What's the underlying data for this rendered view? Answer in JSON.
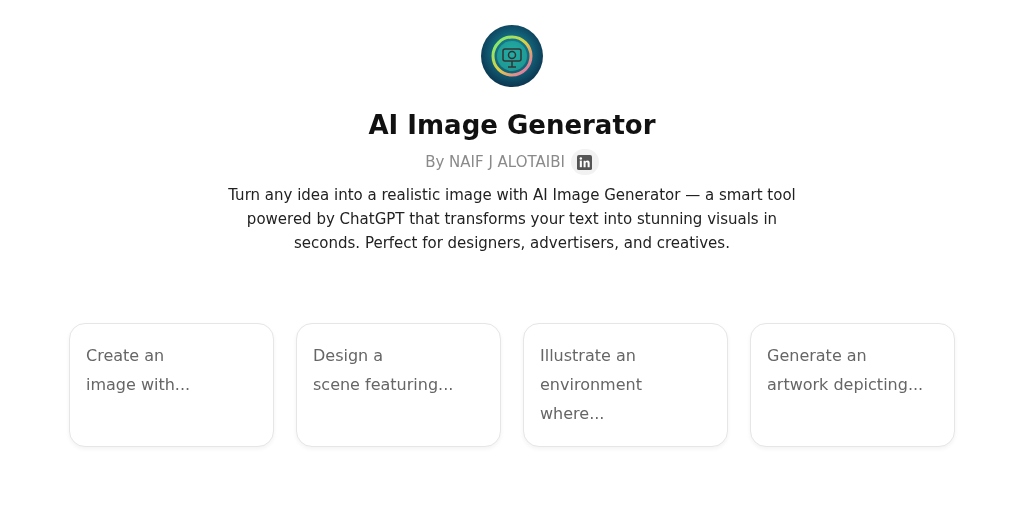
{
  "header": {
    "title": "AI Image Generator",
    "author": "By NAIF J ALOTAIBI",
    "description": "Turn any idea into a realistic image with AI Image Generator — a smart tool powered by ChatGPT that transforms your text into stunning visuals in seconds. Perfect for designers, advertisers, and creatives."
  },
  "suggestions": [
    {
      "text": "Create an\nimage with..."
    },
    {
      "text": "Design a\nscene featuring..."
    },
    {
      "text": "Illustrate an\nenvironment\nwhere..."
    },
    {
      "text": "Generate an\nartwork depicting..."
    }
  ]
}
